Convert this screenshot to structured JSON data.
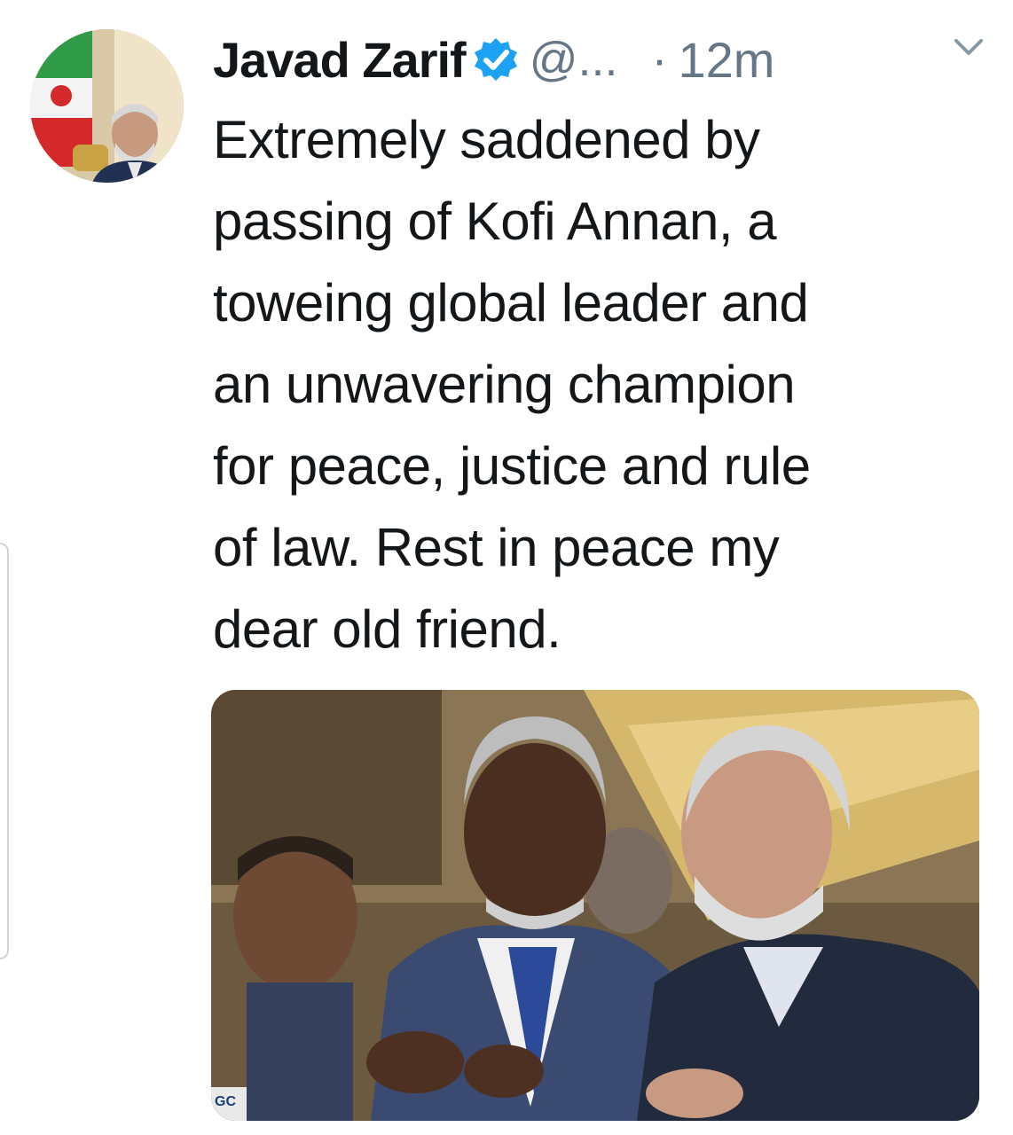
{
  "tweet": {
    "display_name": "Javad Zarif",
    "handle": "@...",
    "separator": "·",
    "timestamp": "12m",
    "verified": true,
    "text": "Extremely saddened by\npassing of Kofi Annan, a\ntoweing global leader and\nan unwavering champion\nfor peace, justice and rule\nof law. Rest in peace my\ndear old friend.",
    "media_caption_fragment": "GC"
  },
  "icons": {
    "verified": "verified-badge-icon",
    "menu": "chevron-down-icon"
  },
  "colors": {
    "verified_blue": "#1da1f2",
    "secondary_text": "#657786",
    "primary_text": "#14171a"
  }
}
